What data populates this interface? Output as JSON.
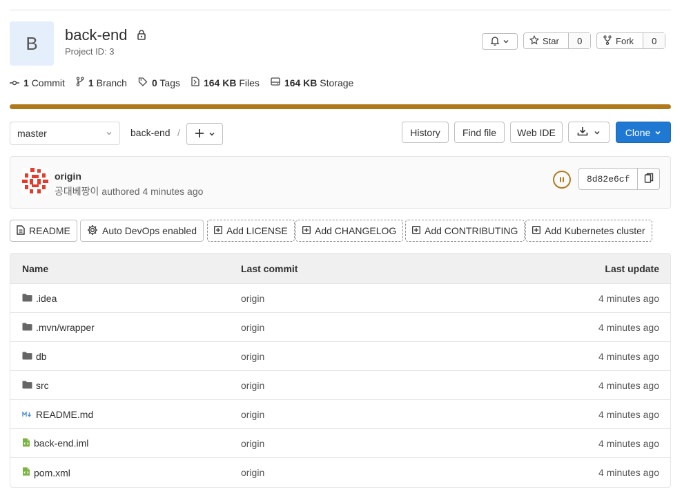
{
  "project": {
    "avatar_letter": "B",
    "title": "back-end",
    "project_id": "Project ID: 3"
  },
  "actions": {
    "star_label": "Star",
    "star_count": "0",
    "fork_label": "Fork",
    "fork_count": "0"
  },
  "stats": {
    "commits_num": "1",
    "commits_label": "Commit",
    "branches_num": "1",
    "branches_label": "Branch",
    "tags_num": "0",
    "tags_label": "Tags",
    "files_size": "164 KB",
    "files_label": "Files",
    "storage_size": "164 KB",
    "storage_label": "Storage"
  },
  "toolbar": {
    "branch": "master",
    "path": "back-end",
    "separator": "/",
    "history": "History",
    "find_file": "Find file",
    "web_ide": "Web IDE",
    "clone": "Clone"
  },
  "last_commit": {
    "title": "origin",
    "author": "공대베짱이",
    "authored": "authored",
    "time": "4 minutes ago",
    "sha": "8d82e6cf"
  },
  "quick_actions": {
    "readme": "README",
    "auto_devops": "Auto DevOps enabled",
    "add_license": "Add LICENSE",
    "add_changelog": "Add CHANGELOG",
    "add_contributing": "Add CONTRIBUTING",
    "add_k8s": "Add Kubernetes cluster"
  },
  "table": {
    "headers": {
      "name": "Name",
      "last_commit": "Last commit",
      "last_update": "Last update"
    },
    "rows": [
      {
        "name": ".idea",
        "commit": "origin",
        "updated": "4 minutes ago",
        "icon": "folder-icon"
      },
      {
        "name": ".mvn/wrapper",
        "commit": "origin",
        "updated": "4 minutes ago",
        "icon": "folder-icon"
      },
      {
        "name": "db",
        "commit": "origin",
        "updated": "4 minutes ago",
        "icon": "folder-icon"
      },
      {
        "name": "src",
        "commit": "origin",
        "updated": "4 minutes ago",
        "icon": "folder-icon"
      },
      {
        "name": "README.md",
        "commit": "origin",
        "updated": "4 minutes ago",
        "icon": "markdown-icon"
      },
      {
        "name": "back-end.iml",
        "commit": "origin",
        "updated": "4 minutes ago",
        "icon": "file-code-icon"
      },
      {
        "name": "pom.xml",
        "commit": "origin",
        "updated": "4 minutes ago",
        "icon": "file-code-icon"
      }
    ]
  },
  "colors": {
    "language_bar": "#b07a1a",
    "clone_button": "#1f78d1",
    "pipeline_paused": "#b07a1a"
  }
}
